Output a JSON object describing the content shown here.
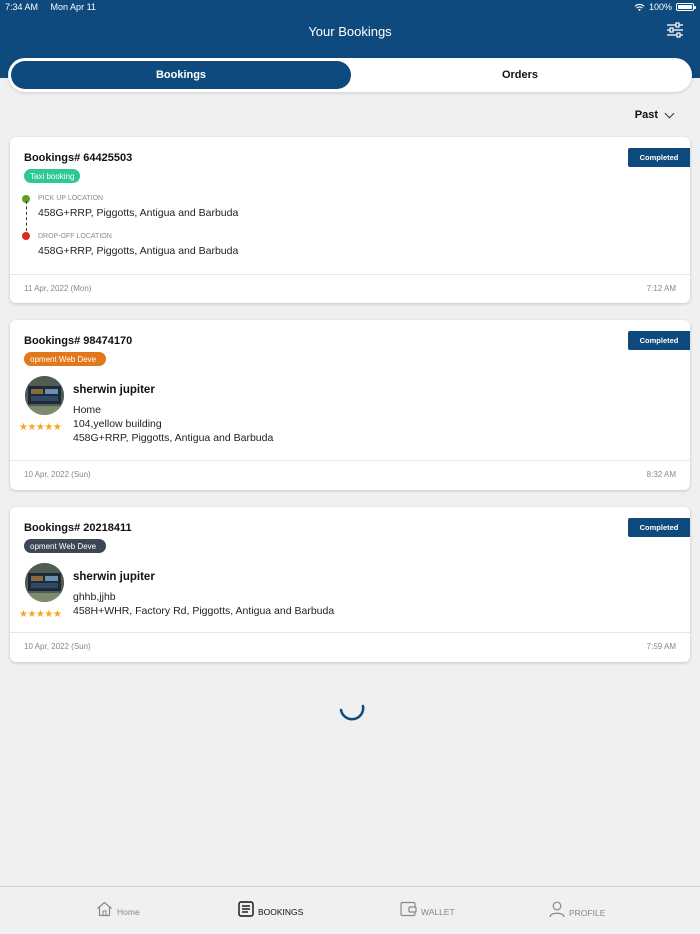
{
  "status_bar": {
    "time": "7:34 AM",
    "date": "Mon Apr 11",
    "battery": "100%"
  },
  "header": {
    "title": "Your Bookings"
  },
  "tabs": [
    {
      "label": "Bookings",
      "active": true
    },
    {
      "label": "Orders",
      "active": false
    }
  ],
  "filter": {
    "selected": "Past"
  },
  "bookings": [
    {
      "number": "Bookings# 64425503",
      "status": "Completed",
      "tag": "Taxi booking",
      "pickup_label": "PICK UP LOCATION",
      "pickup": "458G+RRP, Piggotts, Antigua and Barbuda",
      "dropoff_label": "DROP-OFF LOCATION",
      "dropoff": "458G+RRP, Piggotts, Antigua and Barbuda",
      "date": "11 Apr, 2022 (Mon)",
      "time": "7:12 AM"
    },
    {
      "number": "Bookings# 98474170",
      "status": "Completed",
      "tag": "opment  Web Deve",
      "provider": "sherwin jupiter",
      "rating": "★★★★★",
      "address": [
        "Home",
        "104,yellow building",
        "458G+RRP, Piggotts, Antigua and Barbuda"
      ],
      "date": "10 Apr, 2022 (Sun)",
      "time": "8:32 AM"
    },
    {
      "number": "Bookings# 20218411",
      "status": "Completed",
      "tag": "opment  Web Deve",
      "provider": "sherwin jupiter",
      "rating": "★★★★★",
      "address": [
        "ghhb,jjhb",
        "458H+WHR, Factory Rd, Piggotts, Antigua and Barbuda"
      ],
      "date": "10 Apr, 2022 (Sun)",
      "time": "7:59 AM"
    }
  ],
  "nav": [
    {
      "label": "Home",
      "icon": "home-icon",
      "active": false
    },
    {
      "label": "BOOKINGS",
      "icon": "list-icon",
      "active": true
    },
    {
      "label": "WALLET",
      "icon": "wallet-icon",
      "active": false
    },
    {
      "label": "PROFILE",
      "icon": "person-icon",
      "active": false
    }
  ],
  "colors": {
    "primary": "#0f4a7e",
    "tag_taxi": "#2dc896",
    "tag_orange": "#e2781c",
    "tag_dark": "#3d4655",
    "star": "#f5a623"
  }
}
